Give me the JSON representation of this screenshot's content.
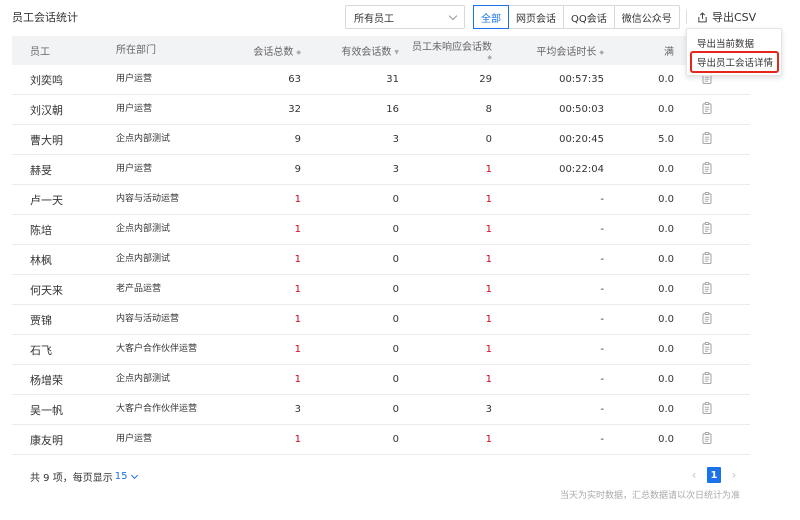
{
  "page": {
    "title": "员工会话统计"
  },
  "filters": {
    "staff_select": "所有员工",
    "channels": [
      "全部",
      "网页会话",
      "QQ会话",
      "微信公众号"
    ],
    "active_channel": "全部"
  },
  "export": {
    "label": "导出CSV",
    "menu": [
      "导出当前数据",
      "导出员工会话详情"
    ],
    "highlighted_item": "导出员工会话详情"
  },
  "table": {
    "headers": {
      "name": "员工",
      "dept": "所在部门",
      "total": "会话总数",
      "valid": "有效会话数",
      "unresp": "员工未响应会话数",
      "avg": "平均会话时长",
      "sat": "满"
    },
    "rows": [
      {
        "name": "刘奕鸣",
        "dept": "用户运营",
        "total": "63",
        "valid": "31",
        "unresp": "29",
        "avg": "00:57:35",
        "sat": "0.0"
      },
      {
        "name": "刘汉朝",
        "dept": "用户运营",
        "total": "32",
        "valid": "16",
        "unresp": "8",
        "avg": "00:50:03",
        "sat": "0.0"
      },
      {
        "name": "曹大明",
        "dept": "企点内部测试",
        "total": "9",
        "valid": "3",
        "unresp": "0",
        "avg": "00:20:45",
        "sat": "5.0"
      },
      {
        "name": "赫旻",
        "dept": "用户运营",
        "total": "9",
        "valid": "3",
        "unresp": "1",
        "avg": "00:22:04",
        "sat": "0.0"
      },
      {
        "name": "卢一天",
        "dept": "内容与活动运营",
        "total": "1",
        "valid": "0",
        "unresp": "1",
        "avg": "-",
        "sat": "0.0"
      },
      {
        "name": "陈培",
        "dept": "企点内部测试",
        "total": "1",
        "valid": "0",
        "unresp": "1",
        "avg": "-",
        "sat": "0.0"
      },
      {
        "name": "林枫",
        "dept": "企点内部测试",
        "total": "1",
        "valid": "0",
        "unresp": "1",
        "avg": "-",
        "sat": "0.0"
      },
      {
        "name": "何天来",
        "dept": "老产品运营",
        "total": "1",
        "valid": "0",
        "unresp": "1",
        "avg": "-",
        "sat": "0.0"
      },
      {
        "name": "贾锦",
        "dept": "内容与活动运营",
        "total": "1",
        "valid": "0",
        "unresp": "1",
        "avg": "-",
        "sat": "0.0"
      },
      {
        "name": "石飞",
        "dept": "大客户合作伙伴运营",
        "total": "1",
        "valid": "0",
        "unresp": "1",
        "avg": "-",
        "sat": "0.0"
      },
      {
        "name": "杨增荣",
        "dept": "企点内部测试",
        "total": "1",
        "valid": "0",
        "unresp": "1",
        "avg": "-",
        "sat": "0.0"
      },
      {
        "name": "吴一帆",
        "dept": "大客户合作伙伴运营",
        "total": "3",
        "valid": "0",
        "unresp": "3",
        "avg": "-",
        "sat": "0.0"
      },
      {
        "name": "康友明",
        "dept": "用户运营",
        "total": "1",
        "valid": "0",
        "unresp": "1",
        "avg": "-",
        "sat": "0.0"
      }
    ]
  },
  "footer": {
    "summary": "共 9 项，每页显示",
    "page_size": "15",
    "current_page": "1",
    "note": "当天为实时数据，汇总数据请以次日统计为准"
  },
  "colors": {
    "accent": "#1a73e8",
    "warning": "#d0021b",
    "highlight_border": "#e4261b"
  }
}
